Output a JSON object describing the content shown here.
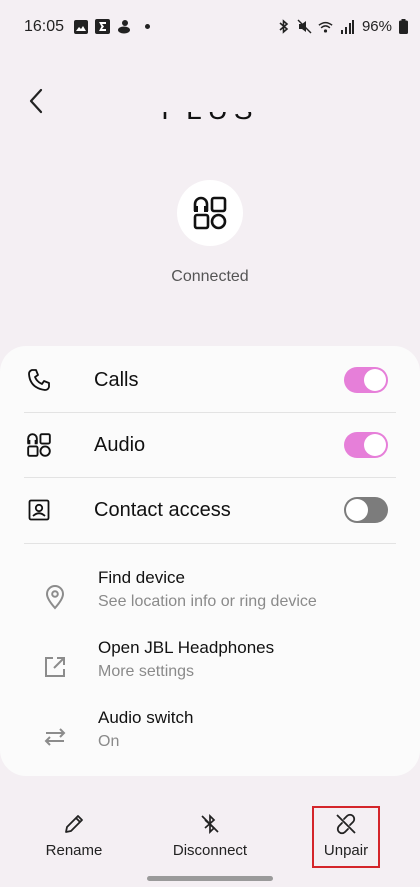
{
  "status_bar": {
    "time": "16:05",
    "battery": "96%"
  },
  "device": {
    "name_partial": "PLUS",
    "status": "Connected"
  },
  "toggles": [
    {
      "label": "Calls",
      "state": "on"
    },
    {
      "label": "Audio",
      "state": "on"
    },
    {
      "label": "Contact access",
      "state": "off"
    }
  ],
  "options": [
    {
      "title": "Find device",
      "subtitle": "See location info or ring device"
    },
    {
      "title": "Open JBL Headphones",
      "subtitle": "More settings"
    },
    {
      "title": "Audio switch",
      "subtitle": "On"
    }
  ],
  "bottom_actions": {
    "rename": "Rename",
    "disconnect": "Disconnect",
    "unpair": "Unpair"
  },
  "colors": {
    "toggle_on": "#e67fd9",
    "toggle_off": "#7c7c7c",
    "highlight_box": "#d4252a",
    "background": "#f4eff3"
  }
}
